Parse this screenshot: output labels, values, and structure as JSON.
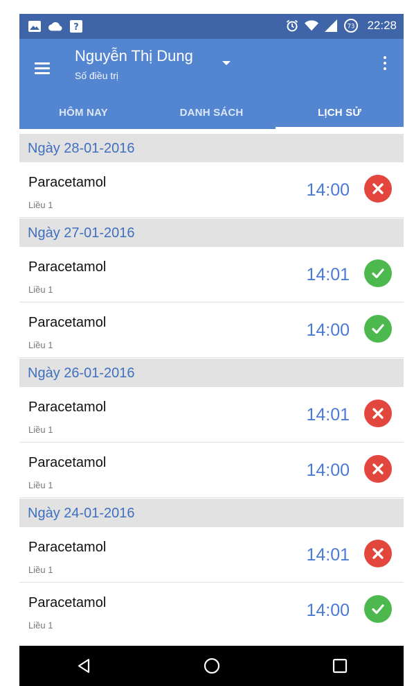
{
  "status_bar": {
    "time": "22:28",
    "left_icons": [
      "image-icon",
      "cloud-icon",
      "help-icon"
    ],
    "right_icons": [
      "alarm-icon",
      "wifi-icon",
      "signal-icon",
      "battery-icon"
    ],
    "battery_level": "73"
  },
  "app_bar": {
    "title": "Nguyễn Thị Dung",
    "subtitle": "Số điều trị",
    "color": "#5385D1",
    "status_color": "#3F65A8"
  },
  "tabs": [
    {
      "label": "HÔM NAY",
      "active": false
    },
    {
      "label": "DANH SÁCH",
      "active": false
    },
    {
      "label": "LỊCH SỬ",
      "active": true
    }
  ],
  "history": [
    {
      "date": "Ngày 28-01-2016",
      "items": [
        {
          "name": "Paracetamol",
          "dose": "Liều 1",
          "time": "14:00",
          "status": "missed"
        }
      ]
    },
    {
      "date": "Ngày 27-01-2016",
      "items": [
        {
          "name": "Paracetamol",
          "dose": "Liều 1",
          "time": "14:01",
          "status": "taken"
        },
        {
          "name": "Paracetamol",
          "dose": "Liều 1",
          "time": "14:00",
          "status": "taken"
        }
      ]
    },
    {
      "date": "Ngày 26-01-2016",
      "items": [
        {
          "name": "Paracetamol",
          "dose": "Liều 1",
          "time": "14:01",
          "status": "missed"
        },
        {
          "name": "Paracetamol",
          "dose": "Liều 1",
          "time": "14:00",
          "status": "missed"
        }
      ]
    },
    {
      "date": "Ngày 24-01-2016",
      "items": [
        {
          "name": "Paracetamol",
          "dose": "Liều 1",
          "time": "14:01",
          "status": "missed"
        },
        {
          "name": "Paracetamol",
          "dose": "Liều 1",
          "time": "14:00",
          "status": "taken"
        }
      ]
    }
  ],
  "colors": {
    "missed": "#E2463C",
    "taken": "#4CB84E",
    "time": "#4A7AD6",
    "date": "#3F6FBF"
  },
  "nav": [
    "back-icon",
    "home-icon",
    "recents-icon"
  ]
}
